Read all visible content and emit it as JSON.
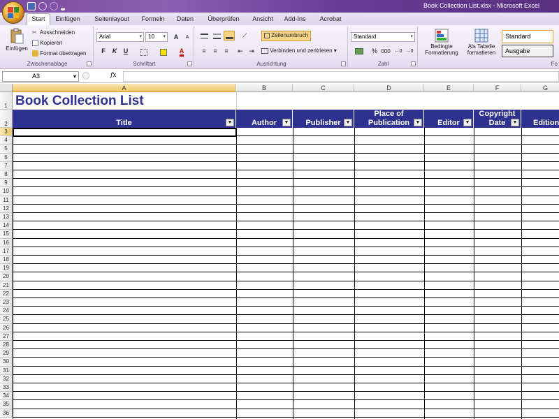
{
  "window": {
    "title": "Book Collection List.xlsx - Microsoft Excel"
  },
  "colors": {
    "header_band": "#2f3191",
    "title_text": "#2f3191",
    "accent_select": "#f0c767"
  },
  "tabs": [
    "Start",
    "Einfügen",
    "Seitenlayout",
    "Formeln",
    "Daten",
    "Überprüfen",
    "Ansicht",
    "Add-Ins",
    "Acrobat"
  ],
  "active_tab": "Start",
  "ribbon": {
    "clipboard": {
      "paste": "Einfügen",
      "cut": "Ausschneiden",
      "copy": "Kopieren",
      "format_painter": "Format übertragen",
      "label": "Zwischenablage"
    },
    "font": {
      "name": "Arial",
      "size": "10",
      "bold": "F",
      "italic": "K",
      "underline": "U",
      "grow": "A",
      "shrink": "A",
      "label": "Schriftart"
    },
    "alignment": {
      "wrap": "Zeilenumbruch",
      "merge": "Verbinden und zentrieren",
      "label": "Ausrichtung"
    },
    "number": {
      "format": "Standard",
      "percent": "%",
      "thousands": "000",
      "label": "Zahl"
    },
    "styles": {
      "conditional": "Bedingte",
      "conditional2": "Formatierung",
      "table": "Als Tabelle",
      "table2": "formatieren",
      "style_standard": "Standard",
      "style_output": "Ausgabe",
      "label": "Fo"
    }
  },
  "formula_bar": {
    "namebox": "A3",
    "fx": "fx",
    "content": ""
  },
  "sheet": {
    "title": "Book Collection List",
    "columns": [
      "A",
      "B",
      "C",
      "D",
      "E",
      "F",
      "G"
    ],
    "selected_column": "A",
    "selected_row": "3",
    "headers": [
      {
        "line1": "",
        "line2": "Title"
      },
      {
        "line1": "",
        "line2": "Author"
      },
      {
        "line1": "",
        "line2": "Publisher"
      },
      {
        "line1": "Place of",
        "line2": "Publication"
      },
      {
        "line1": "",
        "line2": "Editor"
      },
      {
        "line1": "Copyright",
        "line2": "Date"
      },
      {
        "line1": "",
        "line2": "Edition"
      }
    ],
    "dropdown_glyph": "▼",
    "rows": [
      "1",
      "2",
      "3",
      "4",
      "5",
      "6",
      "7",
      "8",
      "9",
      "10",
      "11",
      "12",
      "13",
      "14",
      "15",
      "16",
      "17",
      "18",
      "19",
      "20",
      "21",
      "22",
      "23",
      "24",
      "25",
      "26",
      "27",
      "28",
      "29",
      "30",
      "31",
      "32",
      "33",
      "34",
      "35",
      "36"
    ]
  }
}
